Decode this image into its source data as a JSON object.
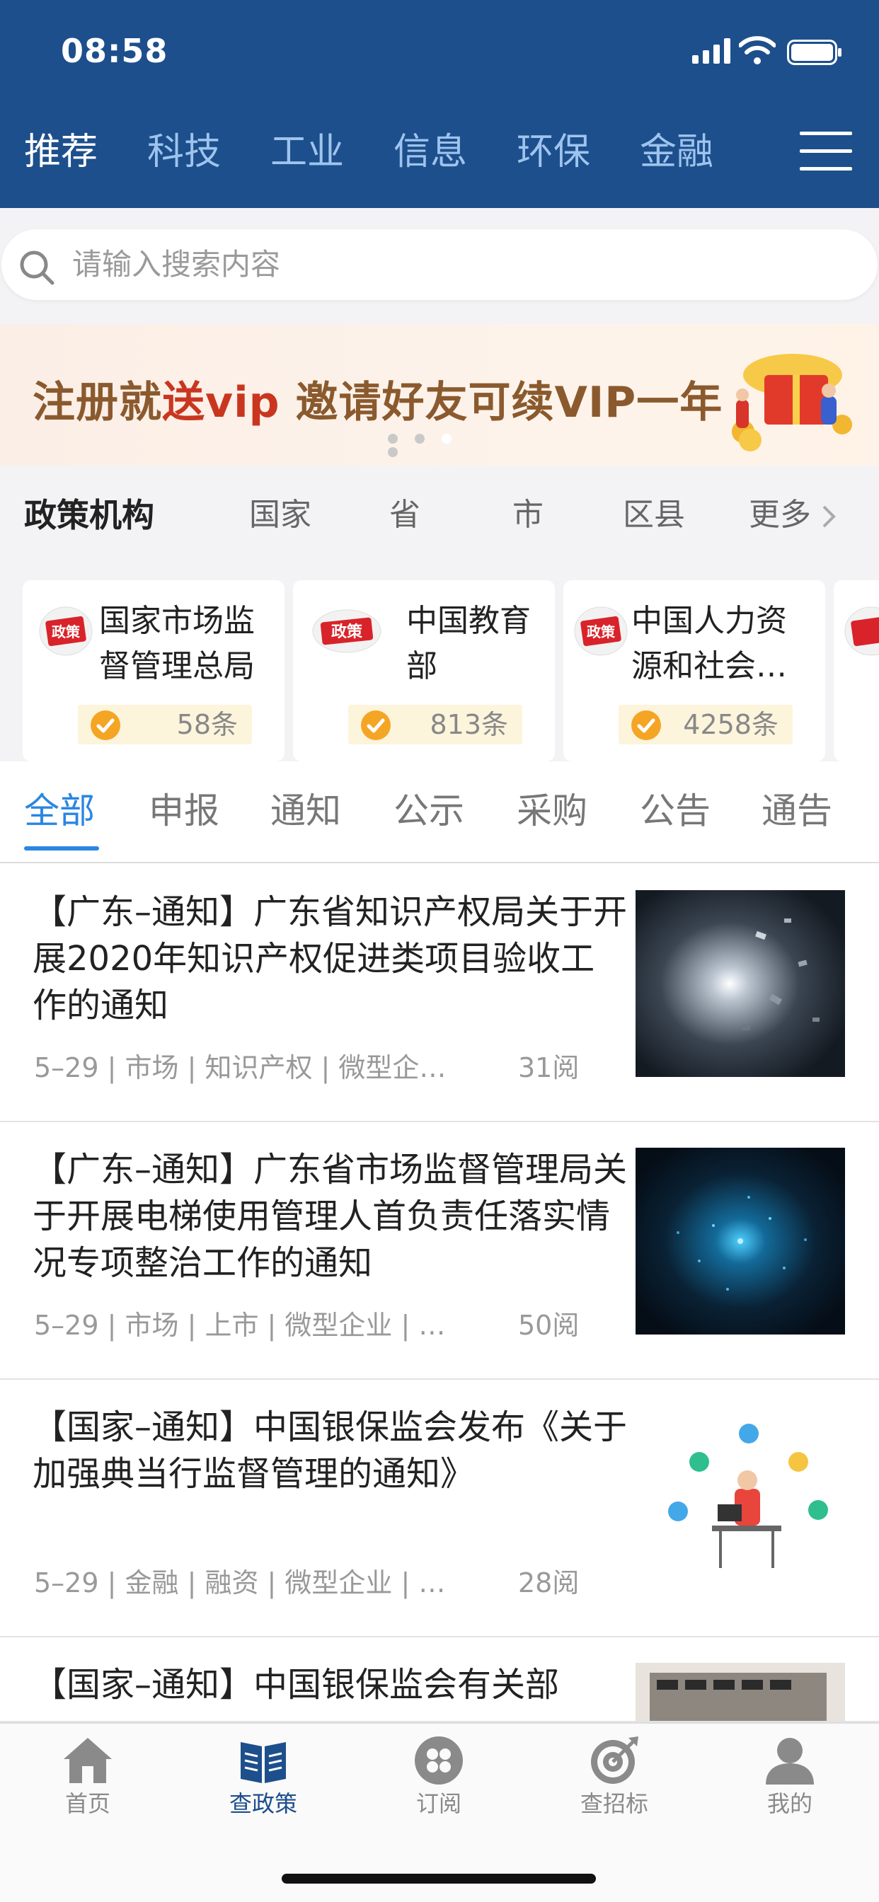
{
  "status_bar": {
    "time": "08:58"
  },
  "nav_tabs": [
    {
      "label": "推荐",
      "active": true
    },
    {
      "label": "科技"
    },
    {
      "label": "工业"
    },
    {
      "label": "信息"
    },
    {
      "label": "环保"
    },
    {
      "label": "金融"
    }
  ],
  "search": {
    "placeholder": "请输入搜索内容"
  },
  "banner": {
    "text_a": "注册就",
    "text_red": "送vip",
    "text_b": "  邀请好友可续VIP一年",
    "pages": 4,
    "active_page": 3
  },
  "org": {
    "title": "政策机构",
    "filters": [
      "国家",
      "省",
      "市",
      "区县",
      "更多"
    ],
    "cards": [
      {
        "name": "国家市场监督管理总局",
        "count": "58条"
      },
      {
        "name": "中国教育部",
        "count": "813条"
      },
      {
        "name": "中国人力资源和社会…",
        "count": "4258条"
      }
    ]
  },
  "categories": [
    "全部",
    "申报",
    "通知",
    "公示",
    "采购",
    "公告",
    "通告"
  ],
  "articles": [
    {
      "title": "【广东–通知】广东省知识产权局关于开展2020年知识产权促进类项目验收工作的通知",
      "meta": "5–29 | 市场 | 知识产权 | 微型企…",
      "reads": "31阅"
    },
    {
      "title": "【广东–通知】广东省市场监督管理局关于开展电梯使用管理人首负责任落实情况专项整治工作的通知",
      "meta": "5–29 | 市场 | 上市 | 微型企业 | …",
      "reads": "50阅"
    },
    {
      "title": "【国家–通知】中国银保监会发布《关于加强典当行监督管理的通知》",
      "meta": "5–29 | 金融 | 融资 | 微型企业 | …",
      "reads": "28阅"
    },
    {
      "title": "【国家–通知】中国银保监会有关部",
      "meta": "",
      "reads": ""
    }
  ],
  "tabbar": [
    {
      "label": "首页",
      "icon": "home-icon"
    },
    {
      "label": "查政策",
      "icon": "book-icon",
      "active": true
    },
    {
      "label": "订阅",
      "icon": "subscribe-icon"
    },
    {
      "label": "查招标",
      "icon": "target-icon"
    },
    {
      "label": "我的",
      "icon": "user-icon"
    }
  ],
  "colors": {
    "header": "#1d4f8c",
    "accent": "#2a86e0",
    "badge_bg": "#fdf4dc"
  }
}
